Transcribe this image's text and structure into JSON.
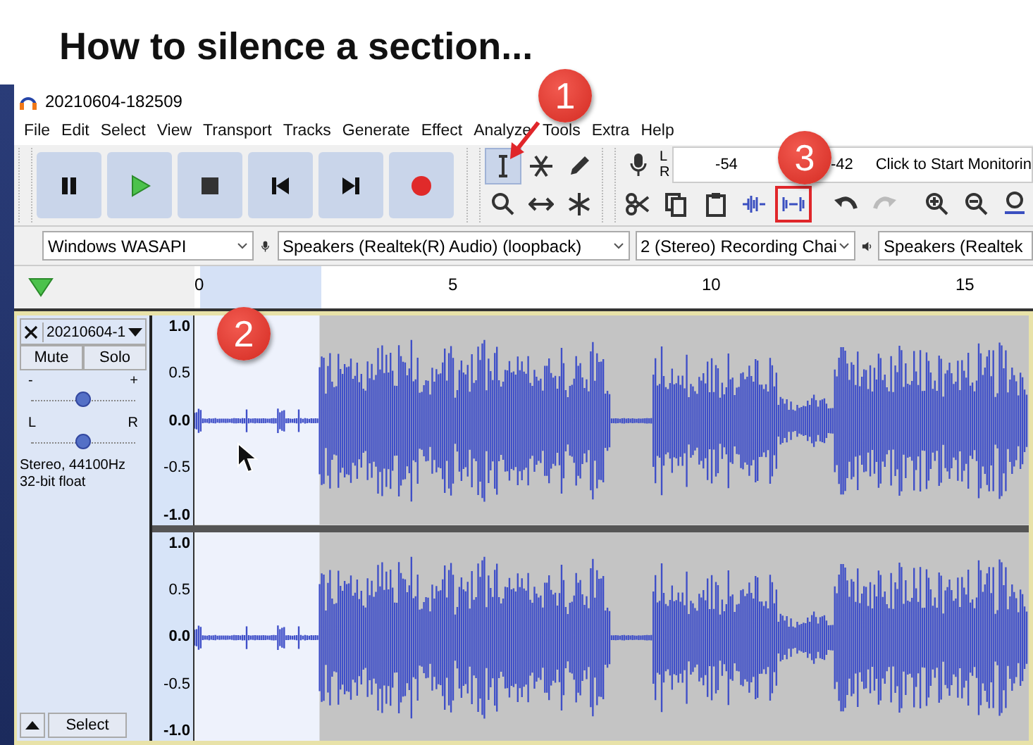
{
  "heading": "How to silence a section...",
  "window": {
    "title": "20210604-182509"
  },
  "menu": [
    "File",
    "Edit",
    "Select",
    "View",
    "Transport",
    "Tracks",
    "Generate",
    "Effect",
    "Analyze",
    "Tools",
    "Extra",
    "Help"
  ],
  "transport": [
    {
      "kind": "pause"
    },
    {
      "kind": "play"
    },
    {
      "kind": "stop"
    },
    {
      "kind": "start"
    },
    {
      "kind": "end"
    },
    {
      "kind": "record"
    }
  ],
  "tools": [
    {
      "kind": "select",
      "selected": true
    },
    {
      "kind": "envelope",
      "selected": false
    },
    {
      "kind": "draw",
      "selected": false
    },
    {
      "kind": "zoom",
      "selected": false
    },
    {
      "kind": "timeshift",
      "selected": false
    },
    {
      "kind": "multi",
      "selected": false
    }
  ],
  "meter": {
    "left": "L",
    "right": "R",
    "ticks": [
      "-54",
      "-42"
    ],
    "prompt": "Click to Start Monitorin"
  },
  "edit_tools": [
    {
      "kind": "cut",
      "highlighted": false
    },
    {
      "kind": "copy",
      "highlighted": false
    },
    {
      "kind": "paste",
      "highlighted": false
    },
    {
      "kind": "trim",
      "highlighted": false
    },
    {
      "kind": "silence",
      "highlighted": true
    },
    {
      "kind": "undo",
      "highlighted": false
    },
    {
      "kind": "redo",
      "highlighted": false
    },
    {
      "kind": "zoomin",
      "highlighted": false
    },
    {
      "kind": "zoomout",
      "highlighted": false
    },
    {
      "kind": "fit",
      "highlighted": false
    }
  ],
  "devices": {
    "host": "Windows WASAPI",
    "input": "Speakers (Realtek(R) Audio) (loopback)",
    "channels": "2 (Stereo) Recording Chai",
    "output": "Speakers (Realtek"
  },
  "ruler": {
    "ticks": [
      "0",
      "5",
      "10",
      "15"
    ]
  },
  "track": {
    "name": "20210604-1",
    "mute": "Mute",
    "solo": "Solo",
    "gain": {
      "minus": "-",
      "plus": "+",
      "level": 0.5
    },
    "pan": {
      "left": "L",
      "right": "R",
      "level": 0.5
    },
    "info": [
      "Stereo, 44100Hz",
      "32-bit float"
    ],
    "select": "Select",
    "channels": [
      {
        "scale": [
          "1.0",
          "0.5",
          "0.0",
          "-0.5",
          "-1.0"
        ]
      },
      {
        "scale": [
          "1.0",
          "0.5",
          "0.0",
          "-0.5",
          "-1.0"
        ]
      }
    ]
  },
  "callouts": [
    "1",
    "2",
    "3"
  ]
}
